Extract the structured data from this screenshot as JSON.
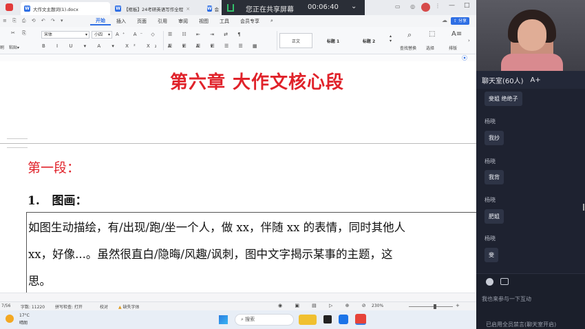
{
  "tabs": [
    {
      "label": "大作文主题词(1).docx"
    },
    {
      "label": "【框板】24考研英语写作全程"
    },
    {
      "label": "会"
    }
  ],
  "menu": [
    "开始",
    "插入",
    "页面",
    "引用",
    "审阅",
    "视图",
    "工具",
    "会员专享"
  ],
  "ribbon": {
    "font_name": "宋体",
    "font_size": "小四",
    "styles": [
      "正文",
      "标题 1",
      "标题 2"
    ],
    "find_replace": "查找替换",
    "select": "选择",
    "layout": "排版",
    "paste": "粘贴",
    "brush": "刷"
  },
  "document": {
    "chapter_title": "第六章  大作文核心段",
    "section_title": "第一段：",
    "item_number": "1.",
    "item_title": "图画：",
    "body_lines": [
      "如图生动描绘，有/出现/跑/坐一个人，做 xx，伴随 xx 的表情，同时其他人",
      "xx，好像...。虽然很直白/隐晦/风趣/讽刺，图中文字揭示某事的主题，这",
      "思。"
    ]
  },
  "status": {
    "page": "7/56",
    "word_count": "字数: 11220",
    "spell": "拼写检查: 打开",
    "proof": "校对",
    "missing_font": "缺失字体",
    "zoom": "230%"
  },
  "taskbar": {
    "weather_temp": "17°C",
    "weather_desc": "晴朗",
    "search_placeholder": "搜索"
  },
  "share": {
    "text": "您正在共享屏幕",
    "time": "00:06:40"
  },
  "topright": {
    "share_btn": "分享"
  },
  "chat": {
    "title": "聊天室(60人)",
    "font_btn": "A+",
    "messages": [
      {
        "user": "",
        "text": "斐姐 绝绝子"
      },
      {
        "user": "杨晓",
        "text": "我抄"
      },
      {
        "user": "杨晓",
        "text": "我背"
      },
      {
        "user": "杨晓",
        "text": "肥姐"
      },
      {
        "user": "杨晓",
        "text": "斐"
      }
    ],
    "input_placeholder": "我也来参与一下互动",
    "footer": "已启用全员禁言(聊天室开启)"
  }
}
